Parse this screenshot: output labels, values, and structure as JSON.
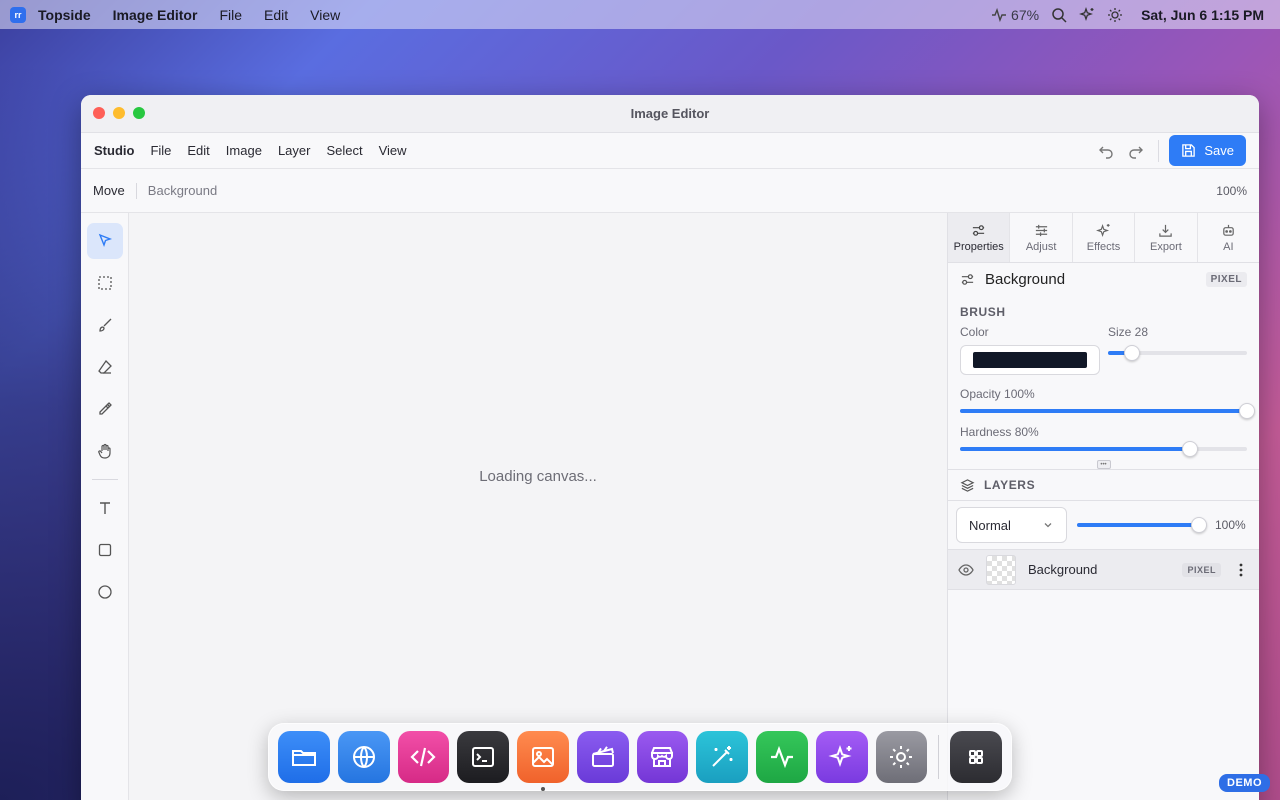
{
  "menubar": {
    "app_logo": "rr",
    "items": [
      "Topside",
      "Image Editor",
      "File",
      "Edit",
      "View"
    ],
    "battery": "67%",
    "clock": "Sat, Jun 6  1:15 PM"
  },
  "window": {
    "title": "Image Editor",
    "menu": {
      "brand": "Studio",
      "items": [
        "File",
        "Edit",
        "Image",
        "Layer",
        "Select",
        "View"
      ],
      "save_label": "Save"
    },
    "tool_options": {
      "tool": "Move",
      "layer": "Background",
      "zoom": "100%"
    },
    "tools": [
      "move-tool",
      "marquee-tool",
      "brush-tool",
      "eraser-tool",
      "eyedropper-tool",
      "hand-tool",
      "text-tool",
      "rectangle-tool",
      "ellipse-tool"
    ],
    "canvas": {
      "loading": "Loading canvas..."
    }
  },
  "panel": {
    "tabs": [
      "Properties",
      "Adjust",
      "Effects",
      "Export",
      "AI"
    ],
    "active_tab": "Properties",
    "layer_name": "Background",
    "layer_type": "PIXEL",
    "brush": {
      "title": "BRUSH",
      "color_label": "Color",
      "color": "#111827",
      "size_label": "Size 28",
      "size_fraction": 0.17,
      "opacity_label": "Opacity 100%",
      "opacity": 1.0,
      "hardness_label": "Hardness 80%",
      "hardness": 0.8
    },
    "layers": {
      "title": "LAYERS",
      "blend_mode": "Normal",
      "opacity": 1.0,
      "opacity_label": "100%",
      "items": [
        {
          "name": "Background",
          "type": "PIXEL"
        }
      ]
    }
  },
  "dock": {
    "apps": [
      "files",
      "browser",
      "code",
      "terminal",
      "photos",
      "video",
      "store",
      "magic",
      "activity",
      "ai",
      "settings"
    ],
    "launcher": "app-grid"
  },
  "colors": {
    "accent": "#2e7cf6"
  },
  "badge": "DEMO"
}
